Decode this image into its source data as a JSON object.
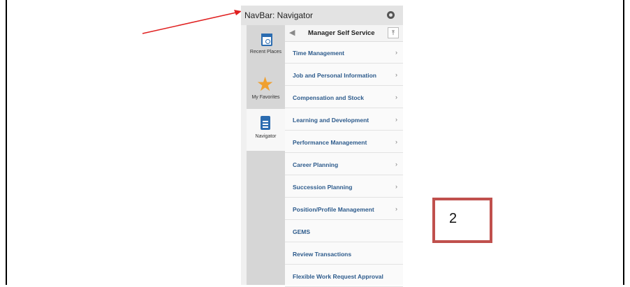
{
  "navbar": {
    "title": "NavBar: Navigator",
    "left_items": [
      {
        "label": "Recent Places",
        "icon": "calendar-clock-icon"
      },
      {
        "label": "My Favorites",
        "icon": "star-icon"
      },
      {
        "label": "Navigator",
        "icon": "document-icon"
      }
    ],
    "menu_title": "Manager Self Service",
    "menu_items": [
      {
        "label": "Time Management",
        "chevron": true
      },
      {
        "label": "Job and Personal Information",
        "chevron": true
      },
      {
        "label": "Compensation and Stock",
        "chevron": true
      },
      {
        "label": "Learning and Development",
        "chevron": true
      },
      {
        "label": "Performance Management",
        "chevron": true
      },
      {
        "label": "Career Planning",
        "chevron": true
      },
      {
        "label": "Succession Planning",
        "chevron": true
      },
      {
        "label": "Position/Profile Management",
        "chevron": true
      },
      {
        "label": "GEMS",
        "chevron": false
      },
      {
        "label": "Review Transactions",
        "chevron": false
      },
      {
        "label": "Flexible Work Request Approval",
        "chevron": false
      }
    ]
  },
  "annotation": {
    "label": "2",
    "color": "#c0504d",
    "arrow_color": "#e02020"
  },
  "chevron_glyph": "›"
}
